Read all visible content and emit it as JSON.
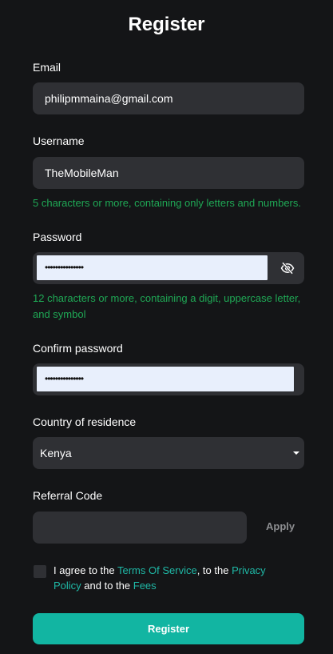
{
  "title": "Register",
  "email": {
    "label": "Email",
    "value": "philipmmaina@gmail.com"
  },
  "username": {
    "label": "Username",
    "value": "TheMobileMan",
    "hint": "5 characters or more, containing only letters and numbers."
  },
  "password": {
    "label": "Password",
    "value_masked": "•••••••••••••••",
    "hint": "12 characters or more, containing a digit, uppercase letter, and symbol",
    "toggle_icon": "eye-off-icon"
  },
  "confirm_password": {
    "label": "Confirm password",
    "value_masked": "•••••••••••••••"
  },
  "country": {
    "label": "Country of residence",
    "selected": "Kenya"
  },
  "referral": {
    "label": "Referral Code",
    "value": "",
    "apply_label": "Apply"
  },
  "agreement": {
    "prefix": "I agree to the ",
    "terms_link": "Terms Of Service",
    "mid1": ", to the ",
    "privacy_link": "Privacy Policy",
    "mid2": " and to the ",
    "fees_link": "Fees",
    "checked": false
  },
  "submit_label": "Register",
  "colors": {
    "background": "#141517",
    "field": "#2f3034",
    "hint": "#1fa855",
    "link": "#1fb8a6",
    "button": "#12b5a2"
  }
}
